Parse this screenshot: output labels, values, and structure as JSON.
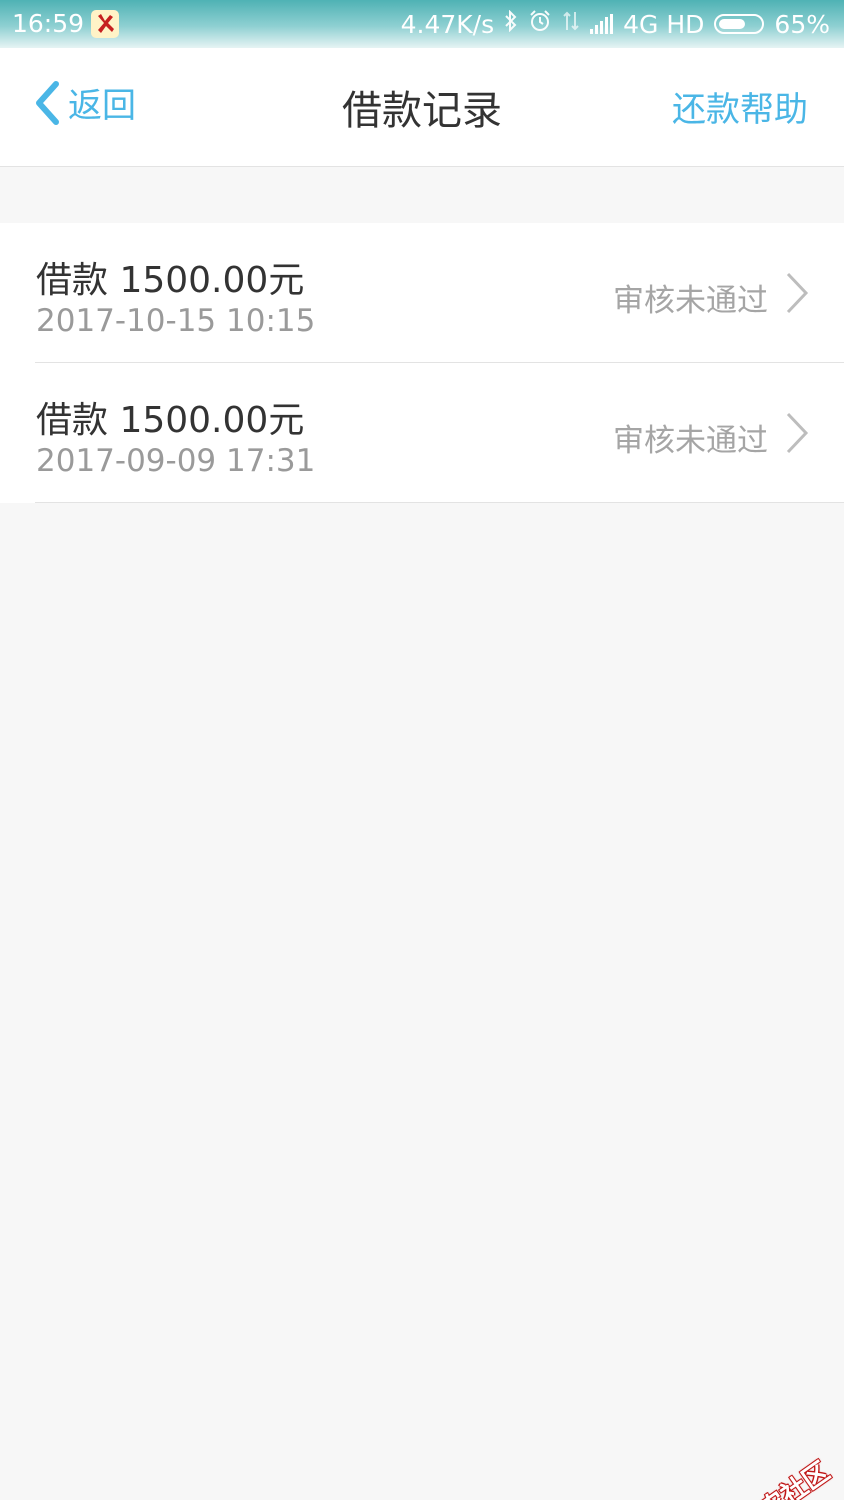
{
  "status_bar": {
    "time": "16:59",
    "net_speed": "4.47K/s",
    "network": "4G HD",
    "battery_percent": "65%",
    "battery_level": 0.65,
    "icons": [
      "app-notification-icon",
      "bluetooth-icon",
      "alarm-icon",
      "data-transfer-icon",
      "signal-icon",
      "battery-icon"
    ]
  },
  "nav": {
    "back_label": "返回",
    "title": "借款记录",
    "help_label": "还款帮助",
    "accent_color": "#4ab6e6"
  },
  "records": [
    {
      "title": "借款 1500.00元",
      "time": "2017-10-15 10:15",
      "status": "审核未通过"
    },
    {
      "title": "借款 1500.00元",
      "time": "2017-09-09 17:31",
      "status": "审核未通过"
    }
  ],
  "watermark": {
    "text": "卡农社区"
  }
}
